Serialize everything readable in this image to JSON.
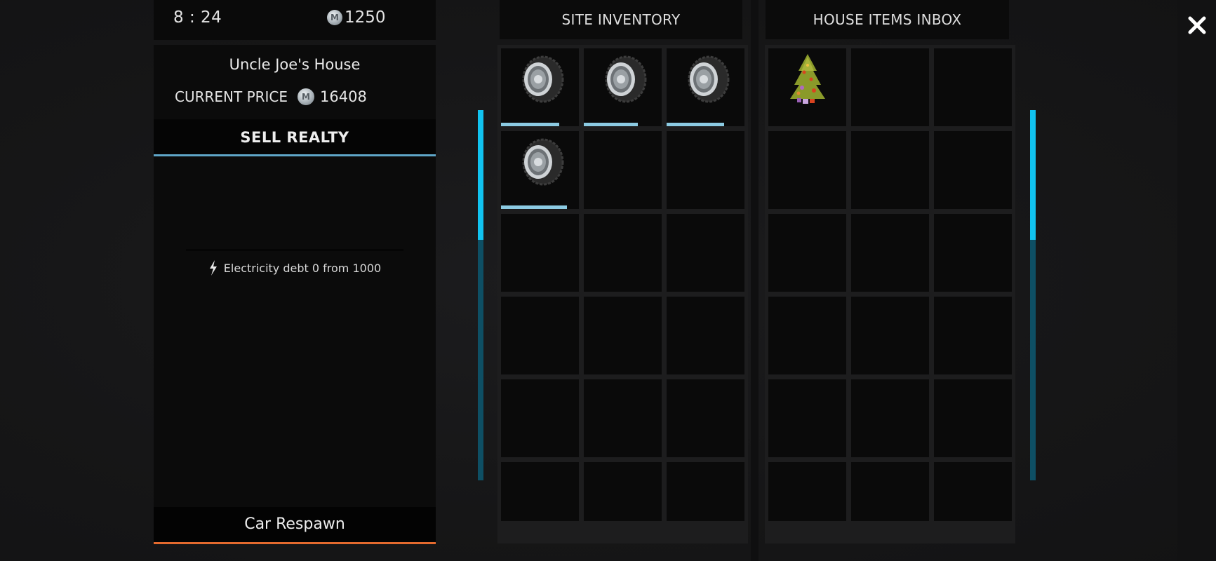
{
  "hud": {
    "time": "8 : 24",
    "balance": "1250",
    "currency_icon": "coin-icon"
  },
  "house": {
    "name": "Uncle Joe's House",
    "price_label": "CURRENT PRICE",
    "price": "16408"
  },
  "actions": {
    "sell_label": "SELL REALTY",
    "respawn_label": "Car Respawn"
  },
  "electricity": {
    "icon": "lightning-icon",
    "text": "Electricity debt 0 from 1000"
  },
  "site_inventory": {
    "title": "SITE INVENTORY",
    "scroll_position_percent": 35,
    "slots": [
      {
        "item": "wheel",
        "durability_percent": 75
      },
      {
        "item": "wheel",
        "durability_percent": 69
      },
      {
        "item": "wheel",
        "durability_percent": 74
      },
      {
        "item": "wheel",
        "durability_percent": 85
      },
      {
        "item": null
      },
      {
        "item": null
      },
      {
        "item": null
      },
      {
        "item": null
      },
      {
        "item": null
      },
      {
        "item": null
      },
      {
        "item": null
      },
      {
        "item": null
      },
      {
        "item": null
      },
      {
        "item": null
      },
      {
        "item": null
      },
      {
        "item": null
      },
      {
        "item": null
      },
      {
        "item": null
      }
    ]
  },
  "house_inbox": {
    "title": "HOUSE ITEMS INBOX",
    "scroll_position_percent": 35,
    "slots": [
      {
        "item": "christmas-tree"
      },
      {
        "item": null
      },
      {
        "item": null
      },
      {
        "item": null
      },
      {
        "item": null
      },
      {
        "item": null
      },
      {
        "item": null
      },
      {
        "item": null
      },
      {
        "item": null
      },
      {
        "item": null
      },
      {
        "item": null
      },
      {
        "item": null
      },
      {
        "item": null
      },
      {
        "item": null
      },
      {
        "item": null
      },
      {
        "item": null
      },
      {
        "item": null
      },
      {
        "item": null
      }
    ]
  },
  "colors": {
    "accent_blue": "#11c3f0",
    "sell_underline": "#5fa6c8",
    "respawn_underline": "#e46a2e",
    "durability": "#8ccbe3"
  }
}
